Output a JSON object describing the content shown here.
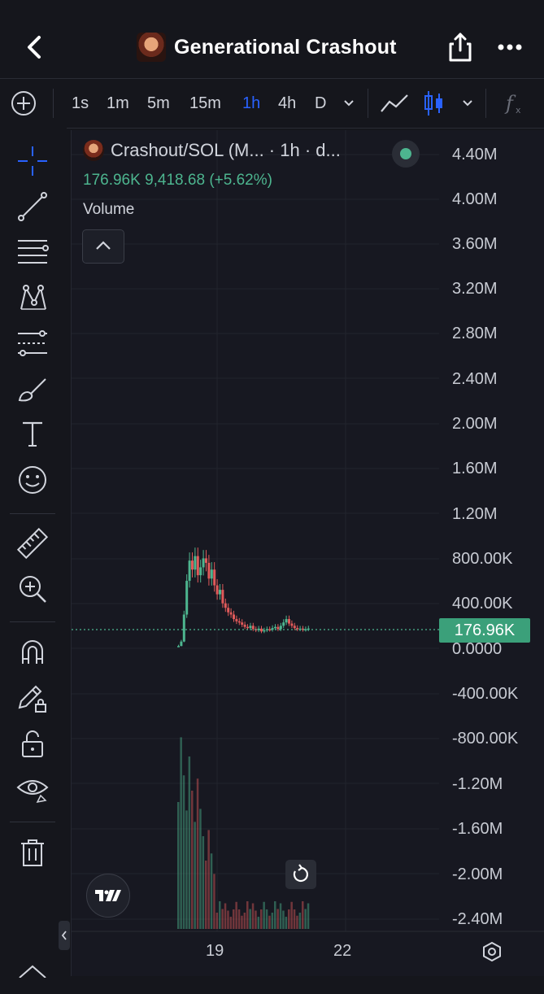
{
  "header": {
    "title": "Generational Crashout"
  },
  "toolbar": {
    "intervals": [
      "1s",
      "1m",
      "5m",
      "15m",
      "1h",
      "4h",
      "D"
    ],
    "active_interval": "1h"
  },
  "legend": {
    "symbol": "Crashout/SOL (M... · 1h · d...",
    "price": "176.96K",
    "change": "9,418.68 (+5.62%)",
    "volume_label": "Volume"
  },
  "y_axis": {
    "labels": [
      "4.40M",
      "4.00M",
      "3.60M",
      "3.20M",
      "2.80M",
      "2.40M",
      "2.00M",
      "1.60M",
      "1.20M",
      "800.00K",
      "400.00K",
      "0.0000",
      "-400.00K",
      "-800.00K",
      "-1.20M",
      "-1.60M",
      "-2.00M",
      "-2.40M"
    ],
    "current_price_tag": "176.96K"
  },
  "x_axis": {
    "labels": [
      "19",
      "22"
    ]
  },
  "colors": {
    "up": "#4db58f",
    "down": "#e05a5a",
    "accent": "#2962ff",
    "price_tag": "#3ba07a"
  },
  "chart_data": {
    "type": "candlestick",
    "title": "Crashout/SOL",
    "interval": "1h",
    "last_price": 176960,
    "change_abs": 9418.68,
    "change_pct": 5.62,
    "ylim": [
      -2400000,
      4400000
    ],
    "x_ticks": [
      "19",
      "22"
    ],
    "notes": "Price spikes to about 850K shortly before day 19, then decays to roughly 150K-300K range; volume bars concentrated near spike."
  }
}
